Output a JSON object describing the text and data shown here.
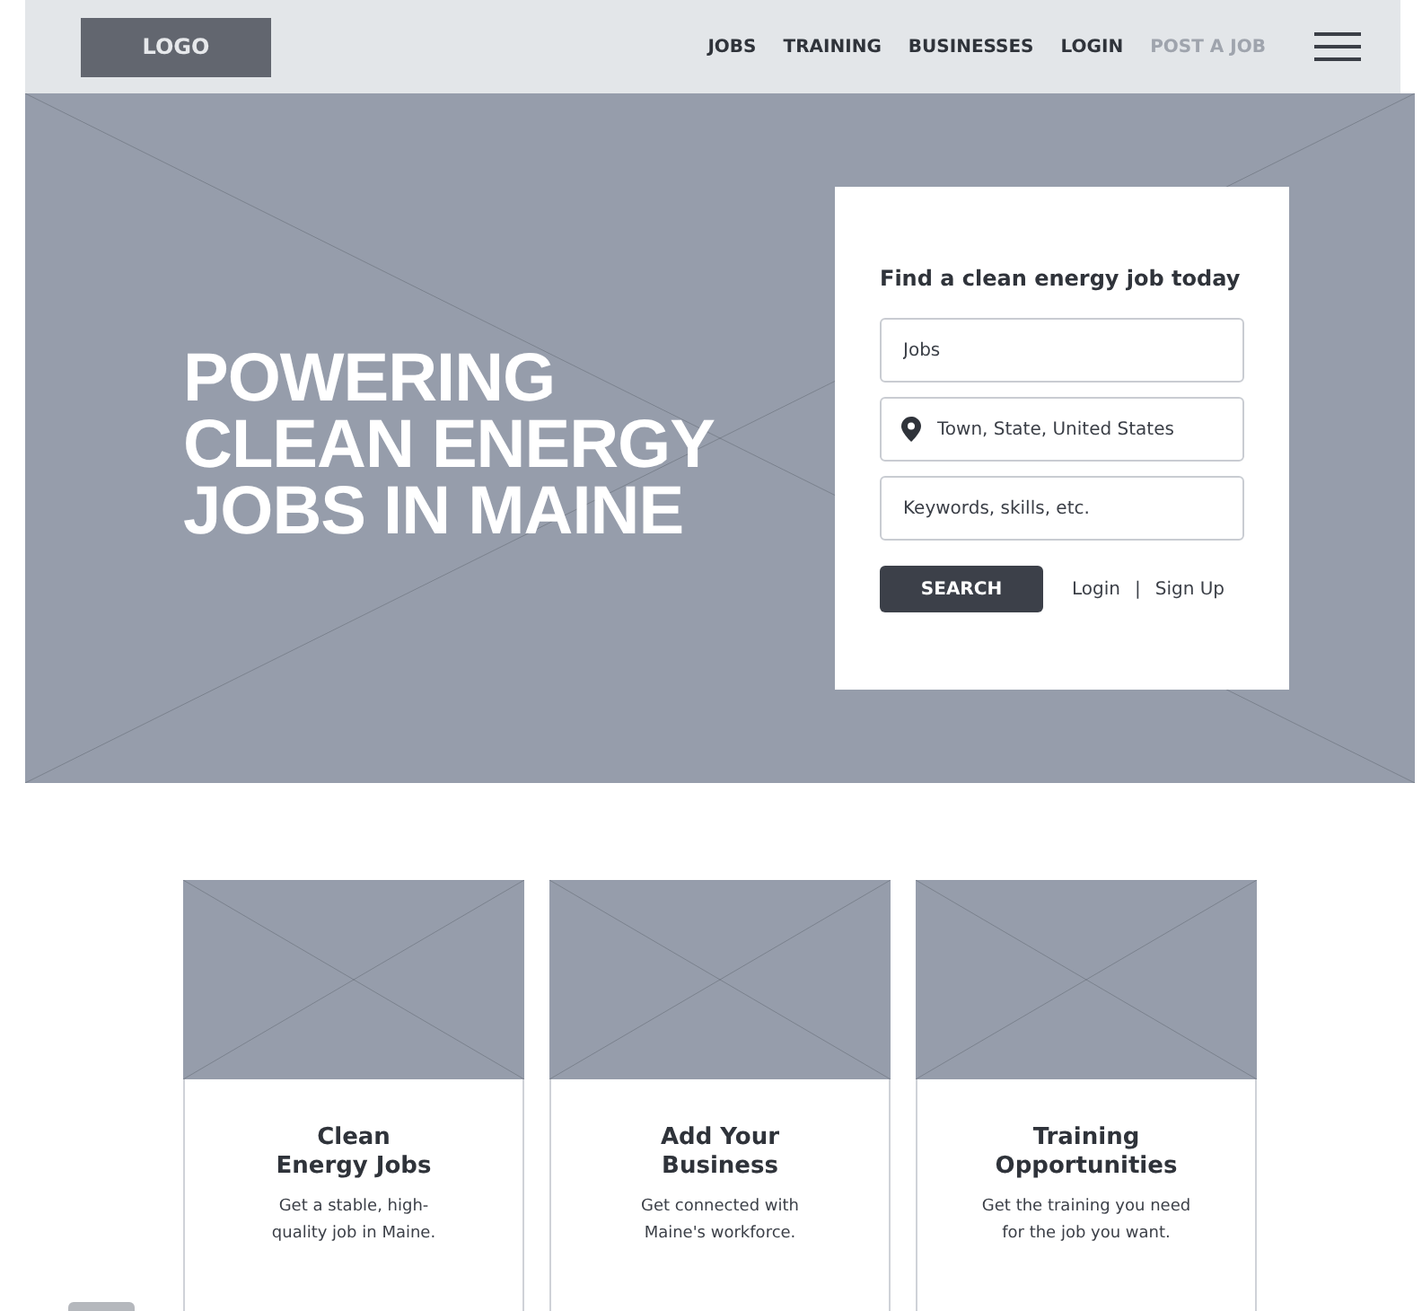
{
  "header": {
    "logo": "LOGO",
    "nav": [
      {
        "label": "JOBS",
        "muted": false
      },
      {
        "label": "TRAINING",
        "muted": false
      },
      {
        "label": "BUSINESSES",
        "muted": false
      },
      {
        "label": "LOGIN",
        "muted": false
      },
      {
        "label": "POST A JOB",
        "muted": true
      }
    ]
  },
  "hero": {
    "headline": "POWERING\nCLEAN ENERGY\nJOBS IN MAINE",
    "search_card": {
      "title": "Find a clean energy job today",
      "fields": [
        {
          "placeholder": "Jobs",
          "kind": "text"
        },
        {
          "placeholder": "Town, State, United States",
          "kind": "location"
        },
        {
          "placeholder": "Keywords, skills, etc.",
          "kind": "text"
        }
      ],
      "button": "SEARCH",
      "login": "Login",
      "separator": "|",
      "signup": "Sign Up"
    }
  },
  "cards": [
    {
      "title": "Clean\nEnergy Jobs",
      "text": "Get a stable, high-\nquality job in Maine."
    },
    {
      "title": "Add Your\nBusiness",
      "text": "Get connected with\nMaine's workforce."
    },
    {
      "title": "Training\nOpportunities",
      "text": "Get the training you need\nfor the job you want."
    }
  ]
}
